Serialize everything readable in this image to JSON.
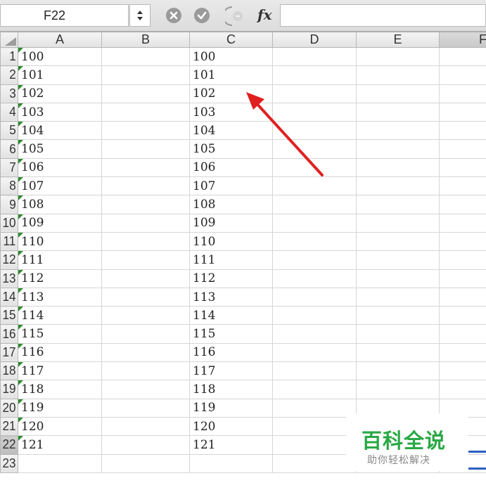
{
  "formula_bar": {
    "name_box": "F22",
    "fx_label": "fx",
    "formula_value": ""
  },
  "columns": [
    "A",
    "B",
    "C",
    "D",
    "E",
    "F"
  ],
  "rows": [
    {
      "label": "1",
      "a": "100",
      "c": "100"
    },
    {
      "label": "2",
      "a": "101",
      "c": "101"
    },
    {
      "label": "3",
      "a": "102",
      "c": "102"
    },
    {
      "label": "4",
      "a": "103",
      "c": "103"
    },
    {
      "label": "5",
      "a": "104",
      "c": "104"
    },
    {
      "label": "6",
      "a": "105",
      "c": "105"
    },
    {
      "label": "7",
      "a": "106",
      "c": "106"
    },
    {
      "label": "8",
      "a": "107",
      "c": "107"
    },
    {
      "label": "9",
      "a": "108",
      "c": "108"
    },
    {
      "label": "10",
      "a": "109",
      "c": "109"
    },
    {
      "label": "11",
      "a": "110",
      "c": "110"
    },
    {
      "label": "12",
      "a": "111",
      "c": "111"
    },
    {
      "label": "13",
      "a": "112",
      "c": "112"
    },
    {
      "label": "14",
      "a": "113",
      "c": "113"
    },
    {
      "label": "15",
      "a": "114",
      "c": "114"
    },
    {
      "label": "16",
      "a": "115",
      "c": "115"
    },
    {
      "label": "17",
      "a": "116",
      "c": "116"
    },
    {
      "label": "18",
      "a": "117",
      "c": "117"
    },
    {
      "label": "19",
      "a": "118",
      "c": "118"
    },
    {
      "label": "20",
      "a": "119",
      "c": "119"
    },
    {
      "label": "21",
      "a": "120",
      "c": "120"
    },
    {
      "label": "22",
      "a": "121",
      "c": "121"
    },
    {
      "label": "23",
      "a": "",
      "c": ""
    }
  ],
  "watermark": {
    "title": "百科全说",
    "subtitle": "助你轻松解决"
  },
  "colors": {
    "text_indicator": "#2e8b2e",
    "arrow": "#e02020",
    "watermark_green": "#29a844"
  },
  "icons": [
    "cancel-icon",
    "confirm-icon",
    "stepper-icon",
    "function-icon",
    "select-all-icon",
    "annotation-arrow-icon"
  ]
}
